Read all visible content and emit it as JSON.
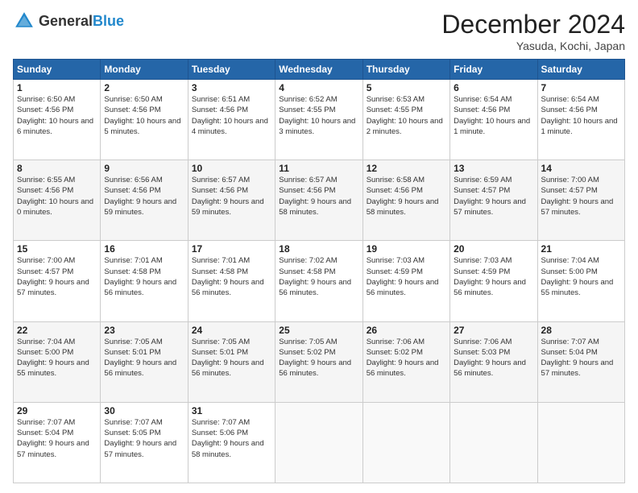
{
  "header": {
    "logo_general": "General",
    "logo_blue": "Blue",
    "month_title": "December 2024",
    "location": "Yasuda, Kochi, Japan"
  },
  "days_of_week": [
    "Sunday",
    "Monday",
    "Tuesday",
    "Wednesday",
    "Thursday",
    "Friday",
    "Saturday"
  ],
  "weeks": [
    [
      {
        "day": 1,
        "sunrise": "6:50 AM",
        "sunset": "4:56 PM",
        "daylight": "10 hours and 6 minutes"
      },
      {
        "day": 2,
        "sunrise": "6:50 AM",
        "sunset": "4:56 PM",
        "daylight": "10 hours and 5 minutes"
      },
      {
        "day": 3,
        "sunrise": "6:51 AM",
        "sunset": "4:56 PM",
        "daylight": "10 hours and 4 minutes"
      },
      {
        "day": 4,
        "sunrise": "6:52 AM",
        "sunset": "4:55 PM",
        "daylight": "10 hours and 3 minutes"
      },
      {
        "day": 5,
        "sunrise": "6:53 AM",
        "sunset": "4:55 PM",
        "daylight": "10 hours and 2 minutes"
      },
      {
        "day": 6,
        "sunrise": "6:54 AM",
        "sunset": "4:56 PM",
        "daylight": "10 hours and 1 minute"
      },
      {
        "day": 7,
        "sunrise": "6:54 AM",
        "sunset": "4:56 PM",
        "daylight": "10 hours and 1 minute"
      }
    ],
    [
      {
        "day": 8,
        "sunrise": "6:55 AM",
        "sunset": "4:56 PM",
        "daylight": "10 hours and 0 minutes"
      },
      {
        "day": 9,
        "sunrise": "6:56 AM",
        "sunset": "4:56 PM",
        "daylight": "9 hours and 59 minutes"
      },
      {
        "day": 10,
        "sunrise": "6:57 AM",
        "sunset": "4:56 PM",
        "daylight": "9 hours and 59 minutes"
      },
      {
        "day": 11,
        "sunrise": "6:57 AM",
        "sunset": "4:56 PM",
        "daylight": "9 hours and 58 minutes"
      },
      {
        "day": 12,
        "sunrise": "6:58 AM",
        "sunset": "4:56 PM",
        "daylight": "9 hours and 58 minutes"
      },
      {
        "day": 13,
        "sunrise": "6:59 AM",
        "sunset": "4:57 PM",
        "daylight": "9 hours and 57 minutes"
      },
      {
        "day": 14,
        "sunrise": "7:00 AM",
        "sunset": "4:57 PM",
        "daylight": "9 hours and 57 minutes"
      }
    ],
    [
      {
        "day": 15,
        "sunrise": "7:00 AM",
        "sunset": "4:57 PM",
        "daylight": "9 hours and 57 minutes"
      },
      {
        "day": 16,
        "sunrise": "7:01 AM",
        "sunset": "4:58 PM",
        "daylight": "9 hours and 56 minutes"
      },
      {
        "day": 17,
        "sunrise": "7:01 AM",
        "sunset": "4:58 PM",
        "daylight": "9 hours and 56 minutes"
      },
      {
        "day": 18,
        "sunrise": "7:02 AM",
        "sunset": "4:58 PM",
        "daylight": "9 hours and 56 minutes"
      },
      {
        "day": 19,
        "sunrise": "7:03 AM",
        "sunset": "4:59 PM",
        "daylight": "9 hours and 56 minutes"
      },
      {
        "day": 20,
        "sunrise": "7:03 AM",
        "sunset": "4:59 PM",
        "daylight": "9 hours and 56 minutes"
      },
      {
        "day": 21,
        "sunrise": "7:04 AM",
        "sunset": "5:00 PM",
        "daylight": "9 hours and 55 minutes"
      }
    ],
    [
      {
        "day": 22,
        "sunrise": "7:04 AM",
        "sunset": "5:00 PM",
        "daylight": "9 hours and 55 minutes"
      },
      {
        "day": 23,
        "sunrise": "7:05 AM",
        "sunset": "5:01 PM",
        "daylight": "9 hours and 56 minutes"
      },
      {
        "day": 24,
        "sunrise": "7:05 AM",
        "sunset": "5:01 PM",
        "daylight": "9 hours and 56 minutes"
      },
      {
        "day": 25,
        "sunrise": "7:05 AM",
        "sunset": "5:02 PM",
        "daylight": "9 hours and 56 minutes"
      },
      {
        "day": 26,
        "sunrise": "7:06 AM",
        "sunset": "5:02 PM",
        "daylight": "9 hours and 56 minutes"
      },
      {
        "day": 27,
        "sunrise": "7:06 AM",
        "sunset": "5:03 PM",
        "daylight": "9 hours and 56 minutes"
      },
      {
        "day": 28,
        "sunrise": "7:07 AM",
        "sunset": "5:04 PM",
        "daylight": "9 hours and 57 minutes"
      }
    ],
    [
      {
        "day": 29,
        "sunrise": "7:07 AM",
        "sunset": "5:04 PM",
        "daylight": "9 hours and 57 minutes"
      },
      {
        "day": 30,
        "sunrise": "7:07 AM",
        "sunset": "5:05 PM",
        "daylight": "9 hours and 57 minutes"
      },
      {
        "day": 31,
        "sunrise": "7:07 AM",
        "sunset": "5:06 PM",
        "daylight": "9 hours and 58 minutes"
      },
      null,
      null,
      null,
      null
    ]
  ],
  "labels": {
    "sunrise": "Sunrise:",
    "sunset": "Sunset:",
    "daylight": "Daylight:"
  }
}
